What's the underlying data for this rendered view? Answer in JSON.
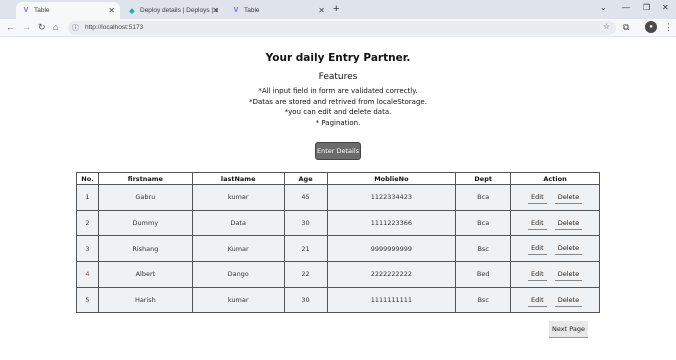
{
  "browser": {
    "tabs": [
      {
        "title": "Table",
        "icon": "vite-icon",
        "active": true
      },
      {
        "title": "Deploy details | Deploys | elegant-...",
        "icon": "netlify-icon",
        "active": false
      },
      {
        "title": "Table",
        "icon": "vite-icon",
        "active": false
      }
    ],
    "address": {
      "url": "http://localhost:5173"
    },
    "accent": "#dfe3eb"
  },
  "page": {
    "title": "Your daily Entry Partner.",
    "features_heading": "Features",
    "features": [
      "*All input field in form are validated correctly.",
      "*Datas are stored and retrived from localeStorage.",
      "*you can edit and delete data.",
      "* Pagination."
    ],
    "enter_button": "Enter Details",
    "table": {
      "headers": [
        "No.",
        "firstname",
        "lastName",
        "Age",
        "MoblieNo",
        "Dept",
        "Action"
      ],
      "rows": [
        {
          "no": "1",
          "firstname": "Gabru",
          "lastname": "kumar",
          "age": "45",
          "mobile": "1122334423",
          "dept": "Bca"
        },
        {
          "no": "2",
          "firstname": "Dummy",
          "lastname": "Data",
          "age": "30",
          "mobile": "1111223366",
          "dept": "Bca"
        },
        {
          "no": "3",
          "firstname": "Rishang",
          "lastname": "Kumar",
          "age": "21",
          "mobile": "9999999999",
          "dept": "Bsc"
        },
        {
          "no": "4",
          "firstname": "Albert",
          "lastname": "Dango",
          "age": "22",
          "mobile": "2222222222",
          "dept": "Bed"
        },
        {
          "no": "5",
          "firstname": "Harish",
          "lastname": "kumar",
          "age": "30",
          "mobile": "1111111111",
          "dept": "Bsc"
        }
      ],
      "edit_label": "Edit",
      "delete_label": "Delete"
    },
    "next_button": "Next Page"
  }
}
